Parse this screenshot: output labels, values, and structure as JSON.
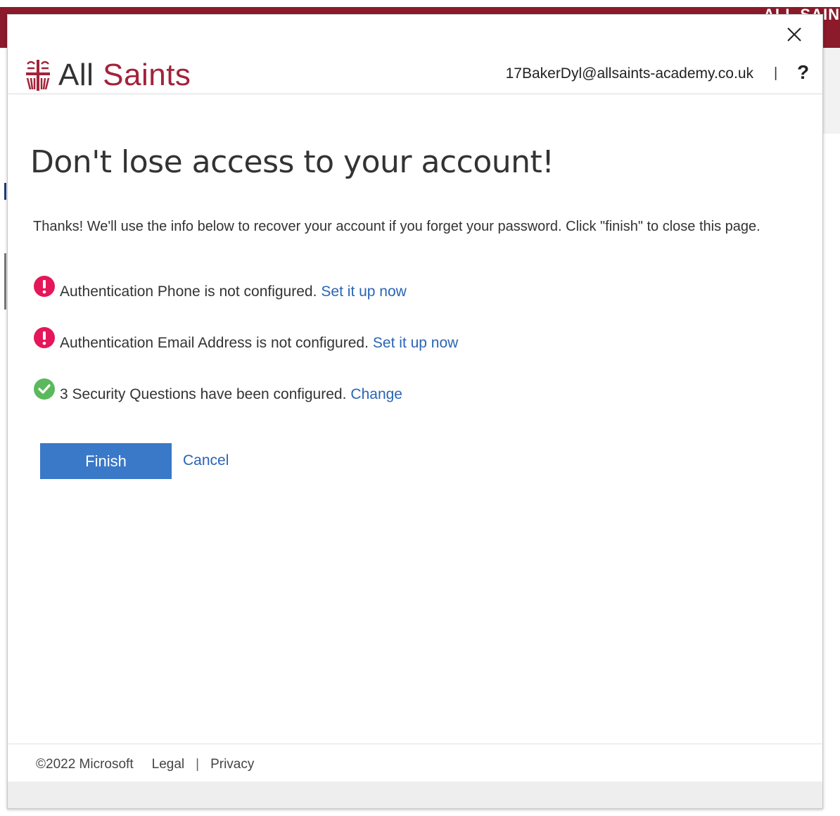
{
  "background": {
    "brand_text": "ALL SAIN",
    "brand_color": "#8b1a2b"
  },
  "dialog": {
    "close_icon": "close-icon",
    "header": {
      "logo_all": "All",
      "logo_saints": "Saints",
      "user_email": "17BakerDyl@allsaints-academy.co.uk",
      "separator": "|",
      "help_label": "?"
    },
    "title": "Don't lose access to your account!",
    "intro": "Thanks! We'll use the info below to recover your account if you forget your password. Click \"finish\" to close this page.",
    "items": [
      {
        "status": "error",
        "icon": "exclamation-icon",
        "message": "Authentication Phone is not configured.",
        "link": "Set it up now"
      },
      {
        "status": "error",
        "icon": "exclamation-icon",
        "message": "Authentication Email Address is not configured.",
        "link": "Set it up now"
      },
      {
        "status": "ok",
        "icon": "checkmark-icon",
        "message": "3 Security Questions have been configured.",
        "link": "Change"
      }
    ],
    "finish_label": "Finish",
    "cancel_label": "Cancel",
    "footer": {
      "copyright": "©2022 Microsoft",
      "legal": "Legal",
      "separator": "|",
      "privacy": "Privacy"
    }
  },
  "colors": {
    "accent": "#3a78c8",
    "link": "#2a64b4",
    "error": "#e3175a",
    "success": "#5cb85c",
    "logo_red": "#a2233a"
  }
}
